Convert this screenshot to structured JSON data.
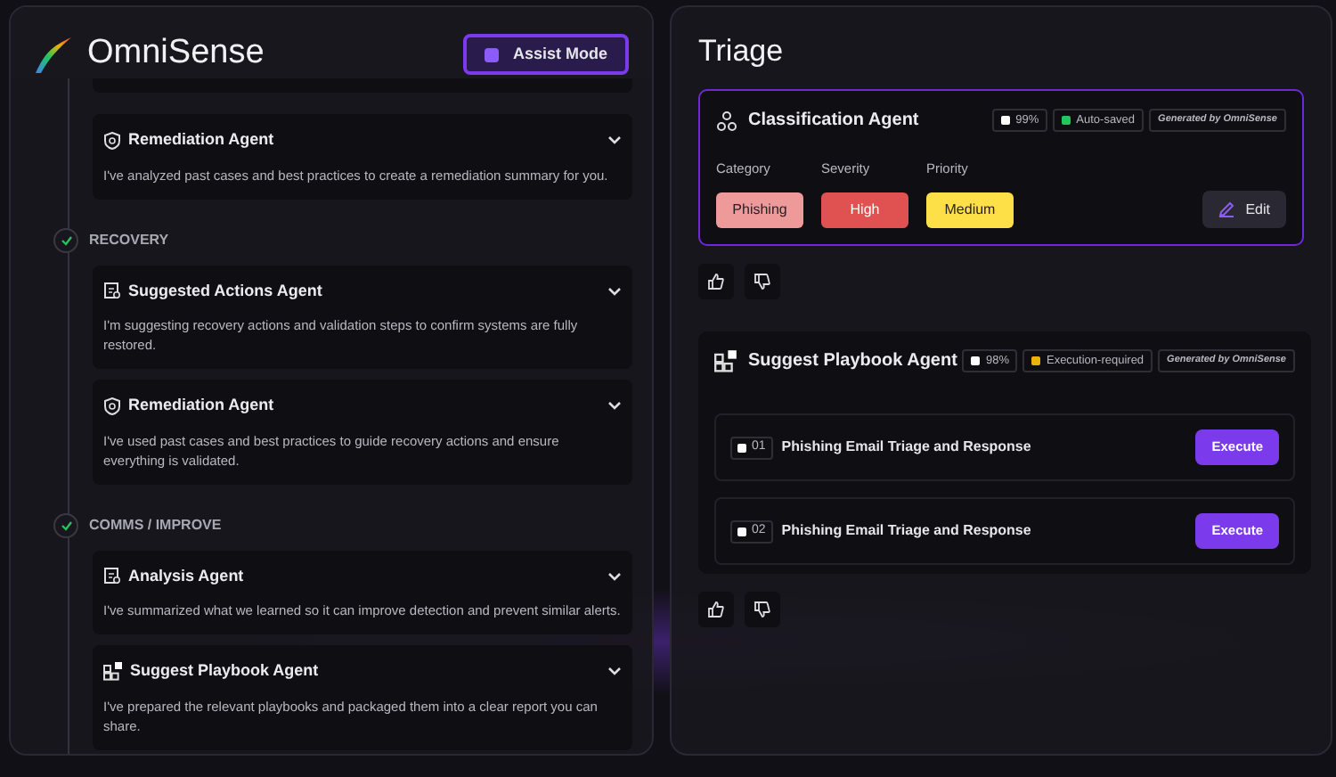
{
  "app": {
    "title": "OmniSense",
    "assist_button": "Assist Mode"
  },
  "timeline": {
    "leading_cards": [
      {
        "title": "Remediation Agent",
        "kind": "shield",
        "expanded": true,
        "body": "I've analyzed past cases and best practices to create a remediation summary for you."
      }
    ],
    "stages": [
      {
        "label": "RECOVERY",
        "completed": true,
        "cards": [
          {
            "title": "Suggested Actions Agent",
            "kind": "actions",
            "expanded": true,
            "body": "I'm suggesting recovery actions and validation steps to confirm systems are fully restored."
          },
          {
            "title": "Remediation Agent",
            "kind": "shield",
            "expanded": true,
            "body": "I've used past cases and best practices to guide recovery actions and ensure everything is validated."
          }
        ]
      },
      {
        "label": "COMMS / IMPROVE",
        "completed": true,
        "cards": [
          {
            "title": "Analysis Agent",
            "kind": "actions",
            "expanded": true,
            "body": "I've summarized what we learned so it can improve detection and prevent similar alerts."
          },
          {
            "title": "Suggest Playbook Agent",
            "kind": "playbook",
            "expanded": true,
            "body": "I've prepared the relevant playbooks and packaged them into a clear report you can share."
          }
        ]
      }
    ]
  },
  "triage": {
    "title": "Triage",
    "classification": {
      "name": "Classification Agent",
      "confidence": "99%",
      "status": {
        "label": "Auto-saved",
        "color": "#22c55e"
      },
      "generated": "Generated by OmniSense",
      "fields": [
        {
          "label": "Category",
          "value": "Phishing",
          "color": "#ef9a9a"
        },
        {
          "label": "Severity",
          "value": "High",
          "color": "#e05252"
        },
        {
          "label": "Priority",
          "value": "Medium",
          "color": "#fde047"
        }
      ],
      "edit_button": "Edit"
    },
    "playbook": {
      "name": "Suggest Playbook Agent",
      "confidence": "98%",
      "status": {
        "label": "Execution-required",
        "color": "#eab308"
      },
      "generated": "Generated by OmniSense",
      "items": [
        {
          "number": "01",
          "title": "Phishing Email Triage and Response",
          "action": "Execute"
        },
        {
          "number": "02",
          "title": "Phishing Email Triage and Response",
          "action": "Execute"
        }
      ]
    }
  }
}
